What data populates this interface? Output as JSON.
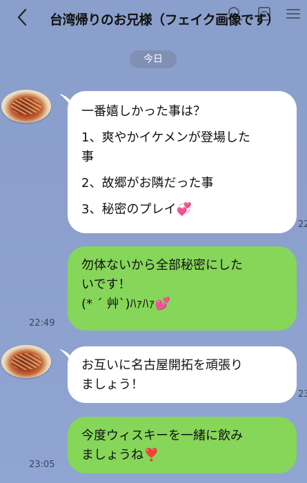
{
  "header": {
    "title": "台湾帰りのお兄様（フェイク画像です）",
    "icons": [
      "back-chevron-icon",
      "search-icon",
      "phone-icon",
      "menu-icon"
    ]
  },
  "date_label": "今日",
  "messages": [
    {
      "side": "in",
      "lines": [
        "一番嬉しかった事は？",
        "",
        "1、爽やかイケメンが登場した",
        "事",
        "",
        "2、故郷がお隣だった事",
        "",
        "3、秘密のプレイ💞"
      ],
      "time": "22"
    },
    {
      "side": "out",
      "lines": [
        "勿体ないから全部秘密にした",
        "いです！",
        "(* ´ 艸`)ﾊｧﾊｧ💕"
      ],
      "time": "22:49"
    },
    {
      "side": "in",
      "lines": [
        "お互いに名古屋開拓を頑張り",
        "ましょう！"
      ],
      "time": "23"
    },
    {
      "side": "out",
      "lines": [
        "今度ウィスキーを一緒に飲み",
        "ましょうね❣️"
      ],
      "time": "23:05"
    }
  ],
  "colors": {
    "background": "#8c9fcd",
    "incoming_bubble": "#ffffff",
    "outgoing_bubble": "#86d65a",
    "date_pill": "#7882a0"
  }
}
